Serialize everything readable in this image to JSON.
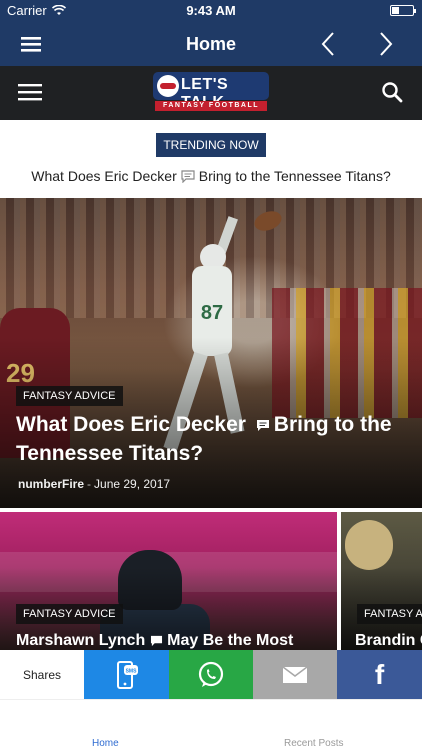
{
  "status_bar": {
    "carrier": "Carrier",
    "time": "9:43 AM"
  },
  "nav": {
    "title": "Home"
  },
  "app": {
    "logo_text": "LET'S TALK",
    "logo_subtitle": "FANTASY FOOTBALL"
  },
  "trending": {
    "badge": "TRENDING NOW",
    "headline_part1": "What Does Eric Decker",
    "headline_part2": "Bring to the Tennessee Titans?"
  },
  "feature": {
    "category": "FANTASY ADVICE",
    "title_part1": "What Does Eric Decker",
    "title_part2": "Bring to the Tennessee Titans?",
    "jersey_number": "87",
    "author": "numberFire",
    "separator": "-",
    "date": "June 29, 2017"
  },
  "cards": [
    {
      "category": "FANTASY ADVICE",
      "title_part1": "Marshawn Lynch",
      "title_part2": "May Be the Most"
    },
    {
      "category": "FANTASY ADVICE",
      "title": "Brandin C"
    }
  ],
  "share": {
    "label": "Shares"
  },
  "tabs": [
    {
      "label": "Home",
      "active": true,
      "color": "#2e6bd1"
    },
    {
      "label": "Recent Posts",
      "active": false,
      "color": "#9a9a9a"
    }
  ],
  "colors": {
    "nav_bg": "#1f3a66",
    "header_bg": "#1f2123",
    "accent_red": "#c3202e"
  }
}
